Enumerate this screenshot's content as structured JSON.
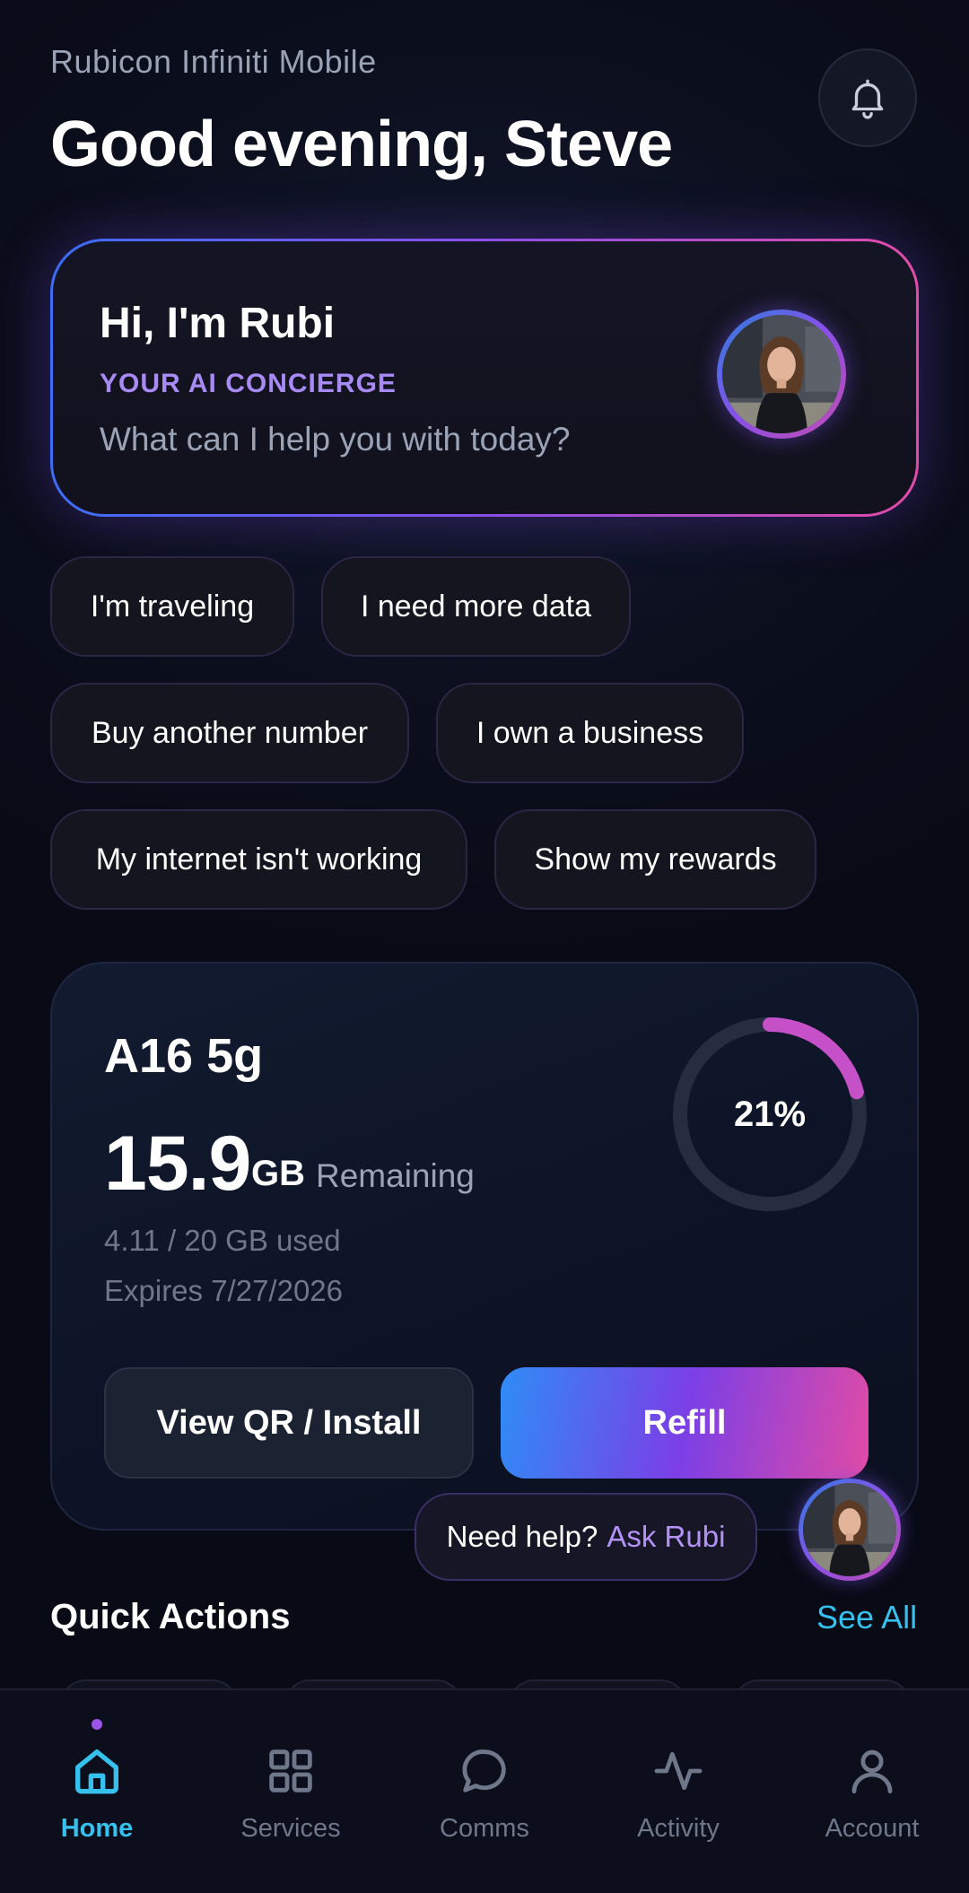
{
  "header": {
    "app_name": "Rubicon Infiniti Mobile",
    "greeting": "Good evening, Steve",
    "notification_icon": "bell-icon"
  },
  "concierge": {
    "title": "Hi, I'm Rubi",
    "subtitle": "YOUR AI CONCIERGE",
    "prompt": "What can I help you with today?",
    "accent_colors": [
      "#3b6df5",
      "#8a4fe8",
      "#e04ba8"
    ]
  },
  "suggestions": [
    "I'm traveling",
    "I need more data",
    "Buy another number",
    "I own a business",
    "My internet isn't working",
    "Show my rewards"
  ],
  "plan": {
    "name": "A16 5g",
    "remaining_value": "15.9",
    "remaining_unit": "GB",
    "remaining_label": "Remaining",
    "used": "4.11 / 20 GB used",
    "expires": "Expires 7/27/2026",
    "usage_percent_label": "21%",
    "usage_fraction": 0.21,
    "ring_color": "#c650c8",
    "secondary_button": "View QR / Install",
    "primary_button": "Refill"
  },
  "help": {
    "text": "Need help?",
    "link": "Ask Rubi"
  },
  "quick_actions": {
    "title": "Quick Actions",
    "see_all": "See All"
  },
  "nav": {
    "items": [
      {
        "label": "Home",
        "icon": "home-icon",
        "active": true
      },
      {
        "label": "Services",
        "icon": "grid-icon",
        "active": false
      },
      {
        "label": "Comms",
        "icon": "chat-bubble-icon",
        "active": false
      },
      {
        "label": "Activity",
        "icon": "activity-pulse-icon",
        "active": false
      },
      {
        "label": "Account",
        "icon": "user-icon",
        "active": false
      }
    ],
    "active_color": "#35c0ee"
  }
}
